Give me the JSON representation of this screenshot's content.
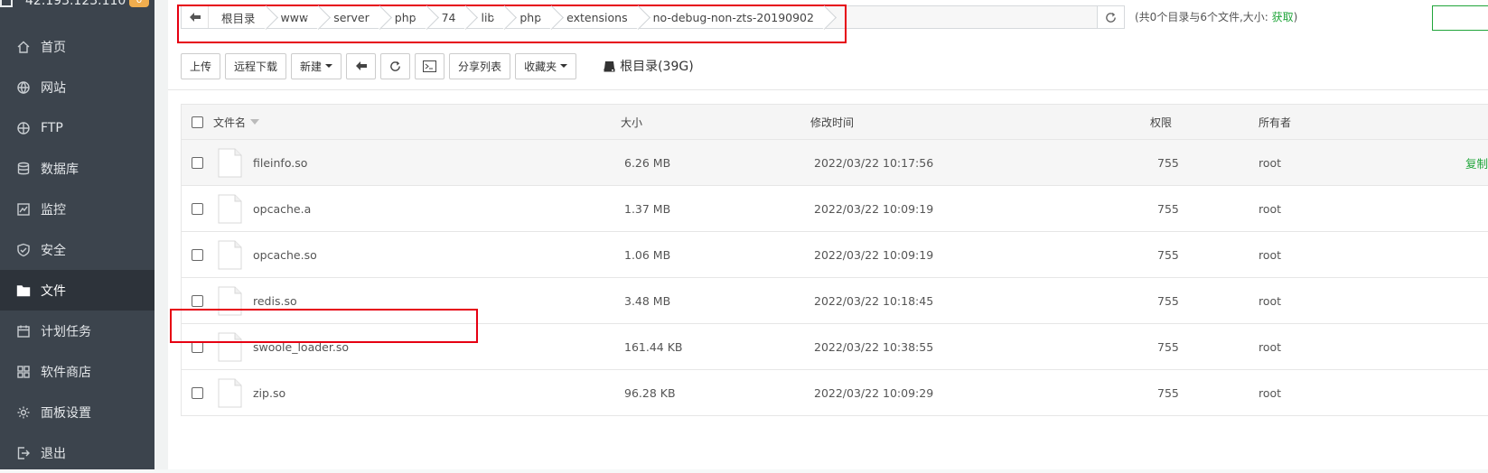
{
  "sidebar": {
    "server_ip": "42.193.123.110",
    "badge": "0",
    "items": [
      {
        "label": "首页",
        "icon": "home-icon"
      },
      {
        "label": "网站",
        "icon": "globe-icon"
      },
      {
        "label": "FTP",
        "icon": "ftp-icon"
      },
      {
        "label": "数据库",
        "icon": "database-icon"
      },
      {
        "label": "监控",
        "icon": "monitor-icon"
      },
      {
        "label": "安全",
        "icon": "shield-icon"
      },
      {
        "label": "文件",
        "icon": "folder-icon",
        "active": true
      },
      {
        "label": "计划任务",
        "icon": "calendar-icon"
      },
      {
        "label": "软件商店",
        "icon": "apps-icon"
      },
      {
        "label": "面板设置",
        "icon": "gear-icon"
      },
      {
        "label": "退出",
        "icon": "logout-icon"
      }
    ]
  },
  "breadcrumb": [
    "根目录",
    "www",
    "server",
    "php",
    "74",
    "lib",
    "php",
    "extensions",
    "no-debug-non-zts-20190902"
  ],
  "dir_info": {
    "text": "(共0个目录与6个文件,大小: ",
    "link": "获取",
    "close": ")"
  },
  "toolbar": {
    "upload": "上传",
    "remote_download": "远程下载",
    "new": "新建",
    "share_list": "分享列表",
    "favorites": "收藏夹",
    "disk": "根目录(39G)"
  },
  "table": {
    "headers": {
      "name": "文件名",
      "size": "大小",
      "mtime": "修改时间",
      "perm": "权限",
      "owner": "所有者"
    },
    "rows": [
      {
        "name": "fileinfo.so",
        "size": "6.26 MB",
        "mtime": "2022/03/22 10:17:56",
        "perm": "755",
        "owner": "root",
        "op": "复制"
      },
      {
        "name": "opcache.a",
        "size": "1.37 MB",
        "mtime": "2022/03/22 10:09:19",
        "perm": "755",
        "owner": "root",
        "op": ""
      },
      {
        "name": "opcache.so",
        "size": "1.06 MB",
        "mtime": "2022/03/22 10:09:19",
        "perm": "755",
        "owner": "root",
        "op": ""
      },
      {
        "name": "redis.so",
        "size": "3.48 MB",
        "mtime": "2022/03/22 10:18:45",
        "perm": "755",
        "owner": "root",
        "op": ""
      },
      {
        "name": "swoole_loader.so",
        "size": "161.44 KB",
        "mtime": "2022/03/22 10:38:55",
        "perm": "755",
        "owner": "root",
        "op": ""
      },
      {
        "name": "zip.so",
        "size": "96.28 KB",
        "mtime": "2022/03/22 10:09:29",
        "perm": "755",
        "owner": "root",
        "op": ""
      }
    ]
  },
  "colors": {
    "accent": "#20a53a",
    "highlight": "#e60012",
    "sidebar": "#3c444d"
  }
}
